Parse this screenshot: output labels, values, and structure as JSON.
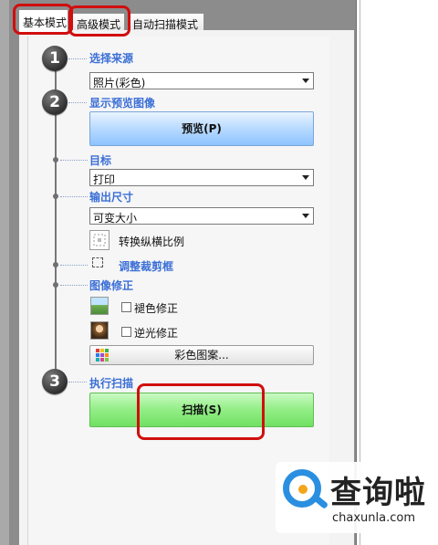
{
  "tabs": [
    "基本模式",
    "高级模式",
    "自动扫描模式"
  ],
  "steps": [
    "1",
    "2",
    "3"
  ],
  "sections": {
    "source": {
      "label": "选择来源",
      "value": "照片(彩色)"
    },
    "preview": {
      "label": "显示预览图像",
      "button": "预览(P)"
    },
    "target": {
      "label": "目标",
      "value": "打印"
    },
    "output_size": {
      "label": "输出尺寸",
      "value": "可变大小",
      "convert": "转换纵横比例"
    },
    "crop": {
      "label": "调整裁剪框"
    },
    "image_correction": {
      "label": "图像修正",
      "fade": "褪色修正",
      "backlight": "逆光修正",
      "color_pattern": "彩色图案..."
    },
    "scan": {
      "label": "执行扫描",
      "button": "扫描(S)"
    }
  },
  "watermark": {
    "brand": "查询啦",
    "url": "chaxunla.com"
  },
  "colors": {
    "accent_blue": "#3b6fd6",
    "highlight_red": "#d10e0e",
    "scan_green": "#8fee83",
    "preview_blue": "#a9d2ff"
  }
}
